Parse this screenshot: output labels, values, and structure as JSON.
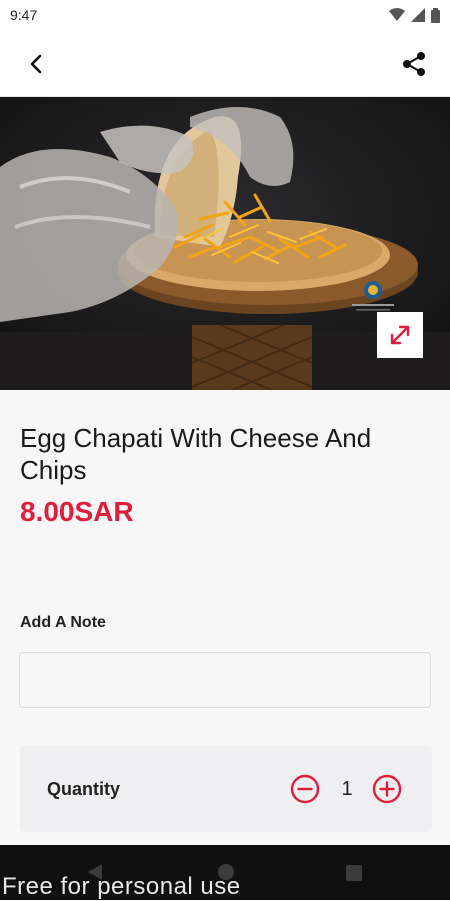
{
  "status_bar": {
    "time": "9:47",
    "icons": [
      "wifi-icon",
      "signal-icon",
      "battery-icon"
    ]
  },
  "toolbar": {
    "back_icon": "back-arrow-icon",
    "share_icon": "share-icon"
  },
  "product": {
    "title": "Egg Chapati With Cheese And Chips",
    "price": "8.00SAR",
    "image_icon": "expand-icon"
  },
  "note": {
    "label": "Add A Note",
    "value": "",
    "placeholder": ""
  },
  "quantity": {
    "label": "Quantity",
    "value": "1",
    "minus_icon": "minus-circle-icon",
    "plus_icon": "plus-circle-icon"
  },
  "watermark": "Free for personal use",
  "colors": {
    "accent": "#e11d3c",
    "background": "#f7f7f8",
    "quantity_box": "#efeff1",
    "nav_bar": "#101010"
  }
}
